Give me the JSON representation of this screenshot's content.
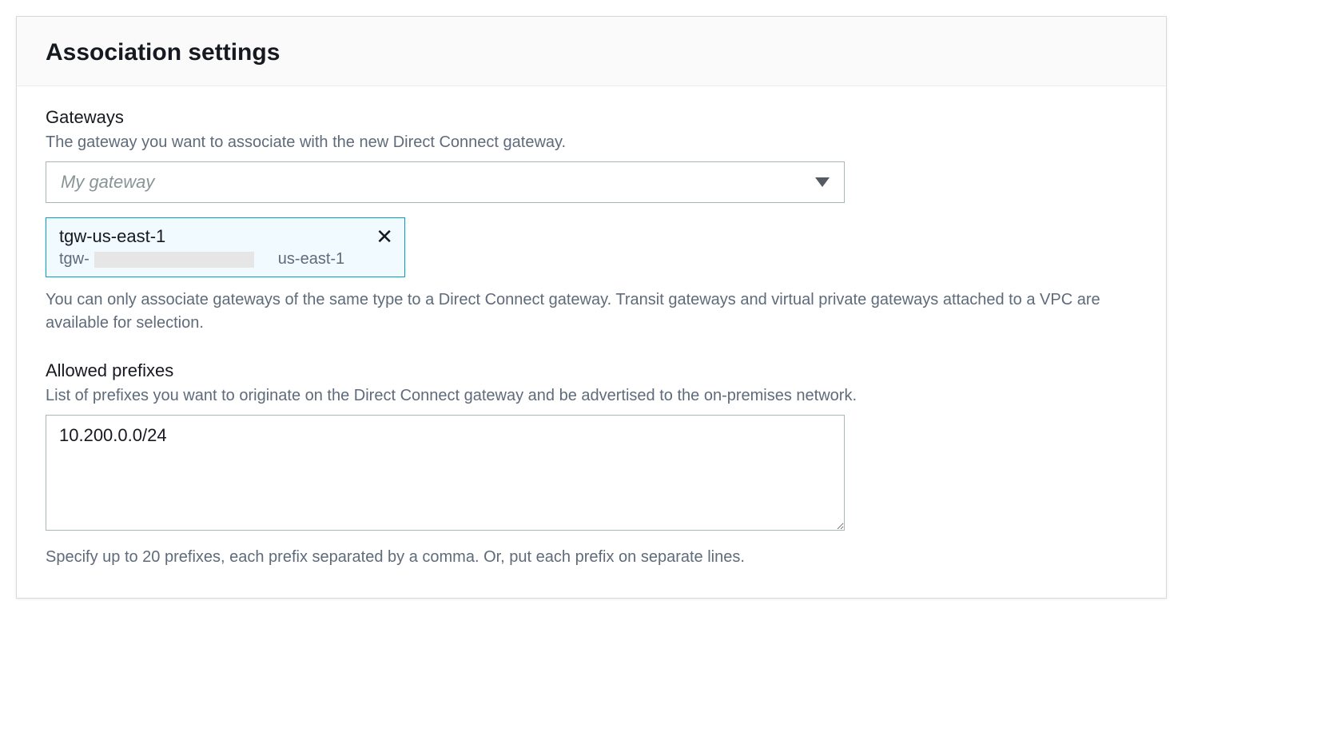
{
  "panel": {
    "title": "Association settings"
  },
  "gateways": {
    "label": "Gateways",
    "description": "The gateway you want to associate with the new Direct Connect gateway.",
    "placeholder": "My gateway",
    "selected": {
      "name": "tgw-us-east-1",
      "id_prefix": "tgw-",
      "region": "us-east-1"
    },
    "help": "You can only associate gateways of the same type to a Direct Connect gateway. Transit gateways and virtual private gateways attached to a VPC are available for selection."
  },
  "prefixes": {
    "label": "Allowed prefixes",
    "description": "List of prefixes you want to originate on the Direct Connect gateway and be advertised to the on-premises network.",
    "value": "10.200.0.0/24",
    "help": "Specify up to 20 prefixes, each prefix separated by a comma. Or, put each prefix on separate lines."
  }
}
